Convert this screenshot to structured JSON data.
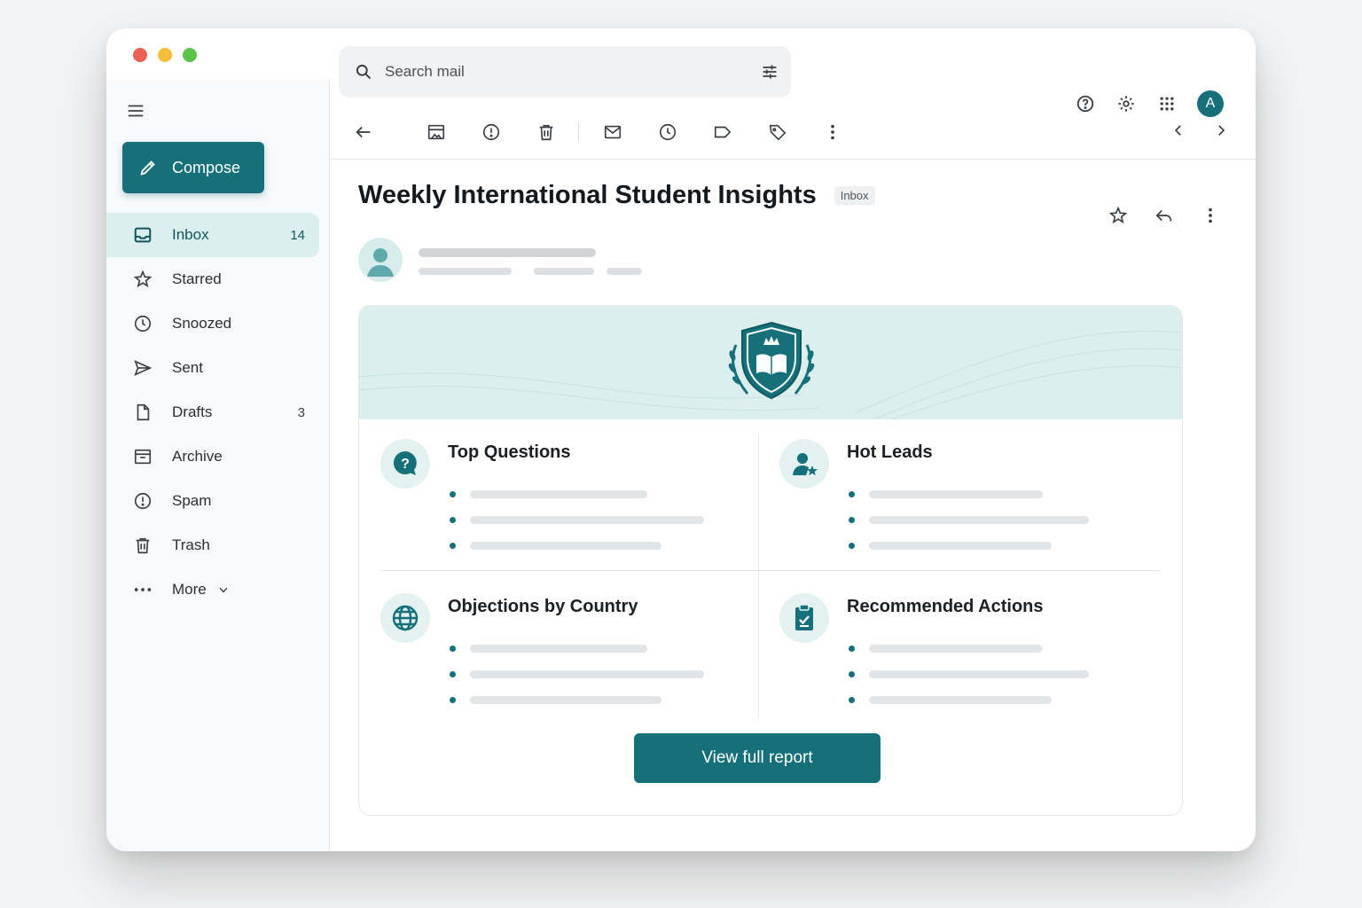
{
  "search": {
    "placeholder": "Search mail"
  },
  "sidebar": {
    "compose_label": "Compose",
    "items": [
      {
        "label": "Inbox",
        "count": "14",
        "icon": "inbox-icon"
      },
      {
        "label": "Starred",
        "count": "",
        "icon": "star-icon"
      },
      {
        "label": "Snoozed",
        "count": "",
        "icon": "clock-icon"
      },
      {
        "label": "Sent",
        "count": "",
        "icon": "send-icon"
      },
      {
        "label": "Drafts",
        "count": "3",
        "icon": "draft-icon"
      },
      {
        "label": "Archive",
        "count": "",
        "icon": "archive-icon"
      },
      {
        "label": "Spam",
        "count": "",
        "icon": "spam-icon"
      },
      {
        "label": "Trash",
        "count": "",
        "icon": "trash-icon"
      },
      {
        "label": "More",
        "count": "",
        "icon": "more-dots-icon"
      }
    ]
  },
  "header": {
    "avatar_initial": "A"
  },
  "message": {
    "subject": "Weekly International Student Insights",
    "label": "Inbox",
    "sections": [
      {
        "title": "Top Questions",
        "icon": "question-bubble-icon"
      },
      {
        "title": "Hot Leads",
        "icon": "user-star-icon"
      },
      {
        "title": "Objections by Country",
        "icon": "globe-icon"
      },
      {
        "title": "Recommended Actions",
        "icon": "clipboard-check-icon"
      }
    ],
    "cta_label": "View full report"
  },
  "colors": {
    "accent": "#16707a",
    "banner": "#dcefee",
    "active_nav": "#dcefef"
  }
}
